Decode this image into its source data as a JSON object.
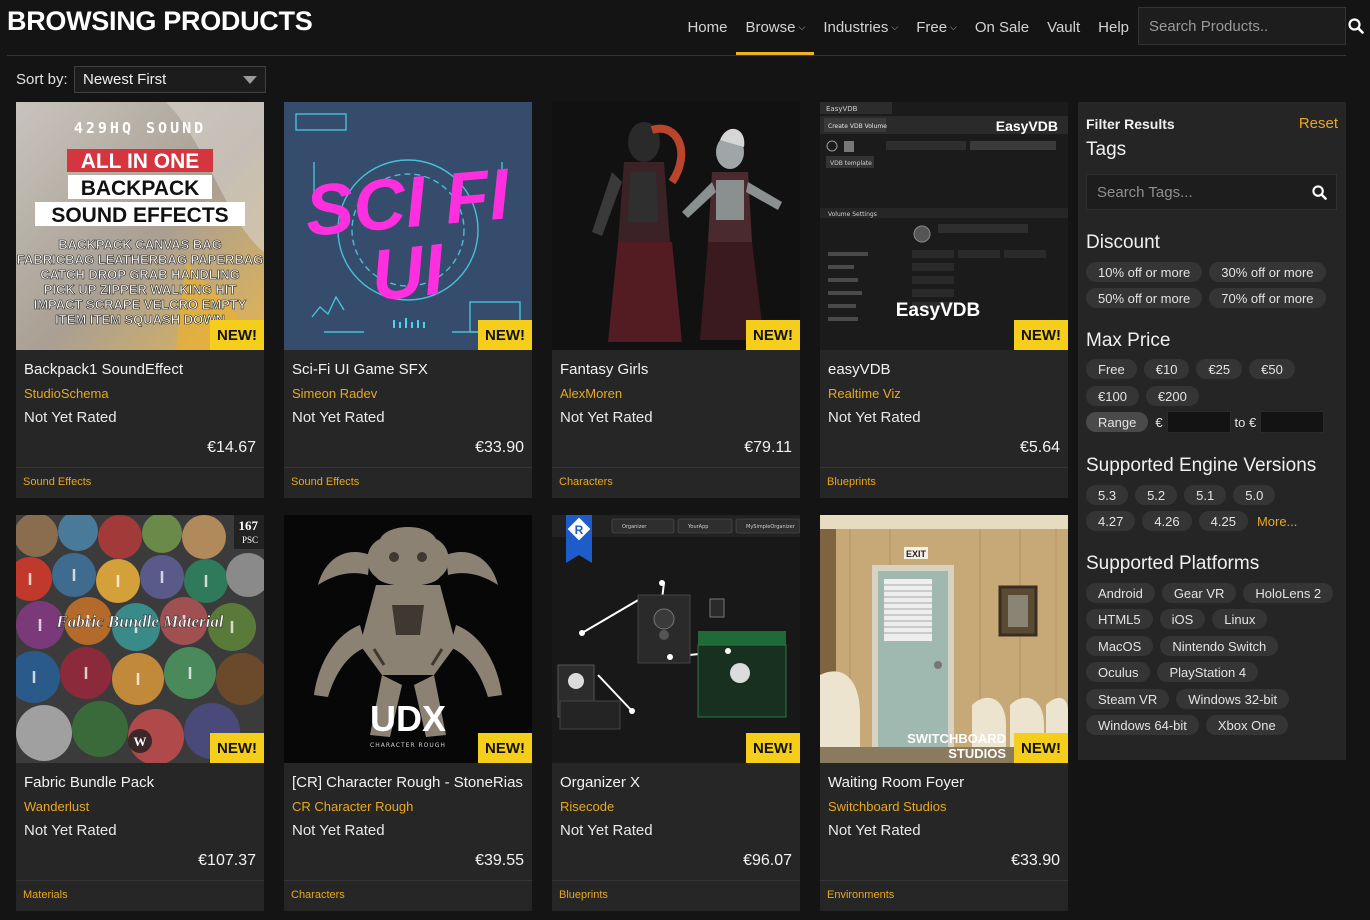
{
  "header": {
    "title": "BROWSING PRODUCTS",
    "nav": [
      {
        "label": "Home",
        "dropdown": false,
        "active": false
      },
      {
        "label": "Browse",
        "dropdown": true,
        "active": true
      },
      {
        "label": "Industries",
        "dropdown": true,
        "active": false
      },
      {
        "label": "Free",
        "dropdown": true,
        "active": false
      },
      {
        "label": "On Sale",
        "dropdown": false,
        "active": false
      },
      {
        "label": "Vault",
        "dropdown": false,
        "active": false
      },
      {
        "label": "Help",
        "dropdown": false,
        "active": false
      }
    ],
    "search_placeholder": "Search Products.."
  },
  "sort": {
    "label": "Sort by:",
    "selected": "Newest First"
  },
  "products": [
    {
      "title": "Backpack1 SoundEffect",
      "seller": "StudioSchema",
      "rating": "Not Yet Rated",
      "price": "€14.67",
      "category": "Sound Effects",
      "badge": "NEW!",
      "art": {
        "top": "429HQ SOUND",
        "lines": [
          "ALL IN ONE",
          "BACKPACK",
          "SOUND EFFECTS"
        ],
        "words": [
          "BACKPACK CANVAS BAG",
          "FABRICBAG LEATHERBAG PAPERBAG",
          "CATCH DROP GRAB HANDLING",
          "PICK UP ZIPPER WALKING HIT",
          "IMPACT SCRAPE VELCRO EMPTY",
          "ITEM ITEM SQUASH DOWN"
        ]
      }
    },
    {
      "title": "Sci-Fi UI Game SFX",
      "seller": "Simeon Radev",
      "rating": "Not Yet Rated",
      "price": "€33.90",
      "category": "Sound Effects",
      "badge": "NEW!",
      "art": {
        "line1": "SCI FI",
        "line2": "UI"
      }
    },
    {
      "title": "Fantasy Girls",
      "seller": "AlexMoren",
      "rating": "Not Yet Rated",
      "price": "€79.11",
      "category": "Characters",
      "badge": "NEW!"
    },
    {
      "title": "easyVDB",
      "seller": "Realtime Viz",
      "rating": "Not Yet Rated",
      "price": "€5.64",
      "category": "Blueprints",
      "badge": "NEW!",
      "art": {
        "tab": "EasyVDB",
        "corner": "EasyVDB",
        "button": "Create VDB Volume",
        "template": "VDB template",
        "section": "Volume Settings",
        "brand": "EasyVDB"
      }
    },
    {
      "title": "Fabric Bundle Pack",
      "seller": "Wanderlust",
      "rating": "Not Yet Rated",
      "price": "€107.37",
      "category": "Materials",
      "badge": "NEW!",
      "art": {
        "count": "167",
        "unit": "PSC",
        "caption": "Fabric Bundle Material"
      }
    },
    {
      "title": "[CR] Character Rough - StoneRias",
      "seller": "CR Character Rough",
      "rating": "Not Yet Rated",
      "price": "€39.55",
      "category": "Characters",
      "badge": "NEW!",
      "art": {
        "logo": "UDX",
        "sub": "CHARACTER ROUGH"
      }
    },
    {
      "title": "Organizer X",
      "seller": "Risecode",
      "rating": "Not Yet Rated",
      "price": "€96.07",
      "category": "Blueprints",
      "badge": "NEW!",
      "art": {
        "mark": "R",
        "tabs": [
          "Organizer",
          "YourApp",
          "MySimpleOrganizer"
        ]
      }
    },
    {
      "title": "Waiting Room Foyer",
      "seller": "Switchboard Studios",
      "rating": "Not Yet Rated",
      "price": "€33.90",
      "category": "Environments",
      "badge": "NEW!",
      "art": {
        "exit": "EXIT",
        "brand1": "SWITCHBOARD",
        "brand2": "STUDIOS"
      }
    }
  ],
  "filters": {
    "title": "Filter Results",
    "reset": "Reset",
    "tags_heading": "Tags",
    "tags_placeholder": "Search Tags...",
    "discount_heading": "Discount",
    "discounts": [
      "10% off or more",
      "30% off or more",
      "50% off or more",
      "70% off or more"
    ],
    "price_heading": "Max Price",
    "prices": [
      "Free",
      "€10",
      "€25",
      "€50",
      "€100",
      "€200"
    ],
    "range_label": "Range",
    "currency": "€",
    "range_to": "to €",
    "engine_heading": "Supported Engine Versions",
    "engines": [
      "5.3",
      "5.2",
      "5.1",
      "5.0",
      "4.27",
      "4.26",
      "4.25"
    ],
    "more_label": "More...",
    "platform_heading": "Supported Platforms",
    "platforms": [
      "Android",
      "Gear VR",
      "HoloLens 2",
      "HTML5",
      "iOS",
      "Linux",
      "MacOS",
      "Nintendo Switch",
      "Oculus",
      "PlayStation 4",
      "Steam VR",
      "Windows 32-bit",
      "Windows 64-bit",
      "Xbox One"
    ]
  },
  "colors": {
    "accent": "#f0b320",
    "badge": "#f5ce1c",
    "card": "#262626",
    "background": "#141414"
  }
}
